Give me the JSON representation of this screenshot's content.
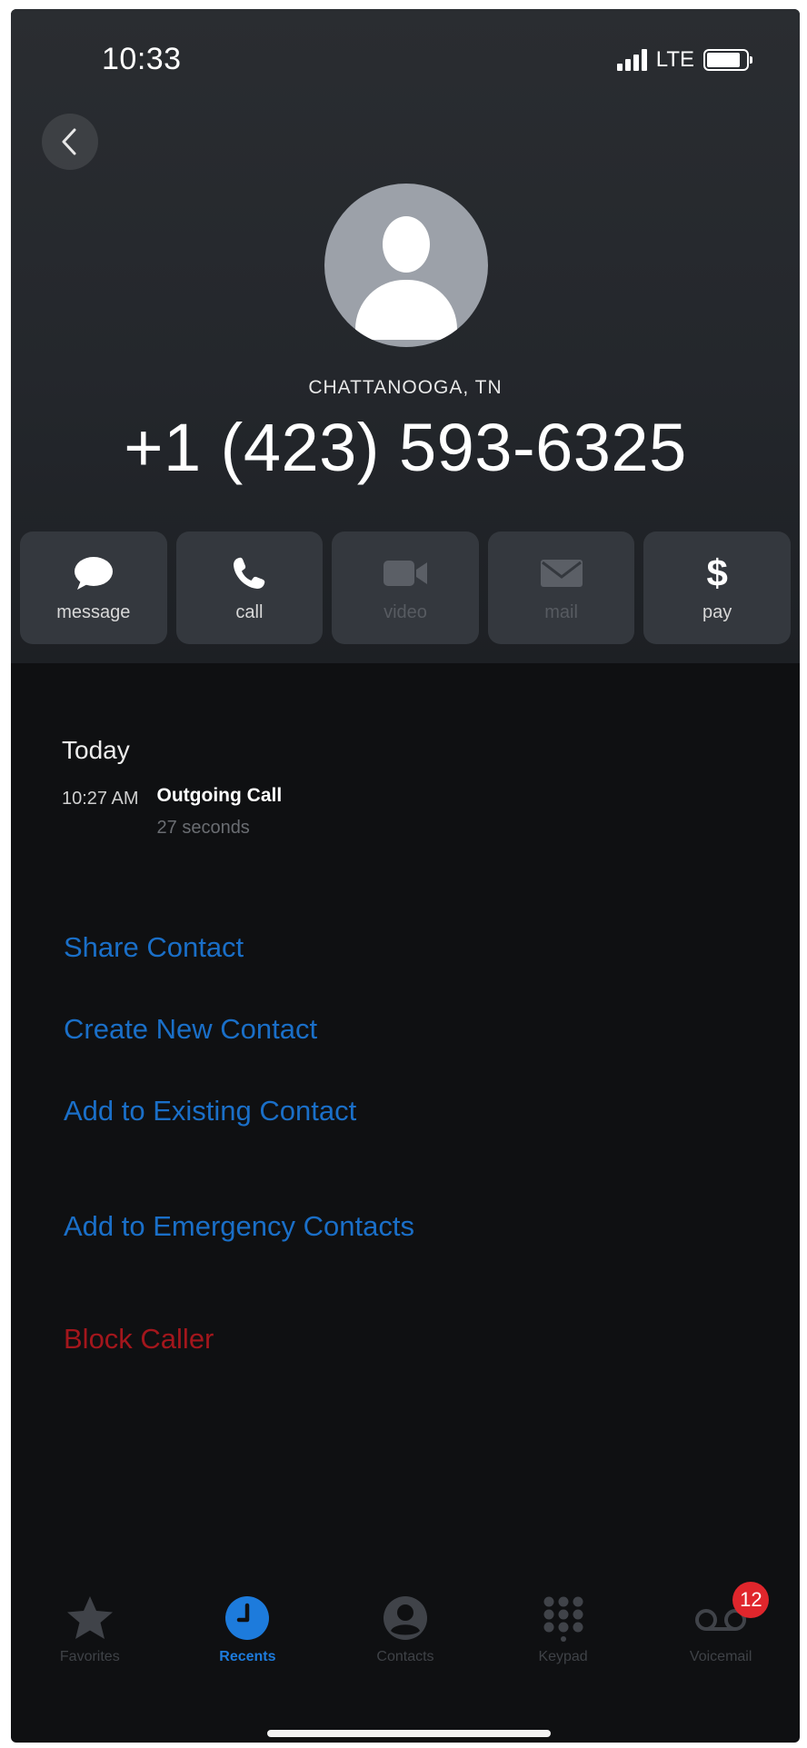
{
  "status_bar": {
    "time": "10:33",
    "network": "LTE",
    "signal_bars": 4,
    "battery_level": 0.85
  },
  "contact": {
    "location": "CHATTANOOGA, TN",
    "phone_number": "+1 (423) 593-6325"
  },
  "actions": [
    {
      "label": "message",
      "icon": "message-bubble-icon",
      "enabled": true
    },
    {
      "label": "call",
      "icon": "phone-icon",
      "enabled": true
    },
    {
      "label": "video",
      "icon": "video-camera-icon",
      "enabled": false
    },
    {
      "label": "mail",
      "icon": "envelope-icon",
      "enabled": false
    },
    {
      "label": "pay",
      "icon": "dollar-icon",
      "glyph": "$",
      "enabled": true
    }
  ],
  "history": {
    "day": "Today",
    "entries": [
      {
        "time": "10:27 AM",
        "type": "Outgoing Call",
        "duration": "27 seconds"
      }
    ]
  },
  "options": {
    "share_contact": "Share Contact",
    "create_new_contact": "Create New Contact",
    "add_to_existing_contact": "Add to Existing Contact",
    "add_to_emergency_contacts": "Add to Emergency Contacts",
    "block_caller": "Block Caller"
  },
  "tabbar": {
    "tabs": [
      {
        "label": "Favorites",
        "icon": "star-icon",
        "active": false
      },
      {
        "label": "Recents",
        "icon": "clock-icon",
        "active": true
      },
      {
        "label": "Contacts",
        "icon": "person-circle-icon",
        "active": false
      },
      {
        "label": "Keypad",
        "icon": "keypad-icon",
        "active": false
      },
      {
        "label": "Voicemail",
        "icon": "voicemail-icon",
        "active": false,
        "badge": "12"
      }
    ]
  },
  "colors": {
    "link": "#1a6fc8",
    "danger": "#a3161c",
    "active_tab": "#1d7bdc",
    "badge": "#e0262c"
  }
}
